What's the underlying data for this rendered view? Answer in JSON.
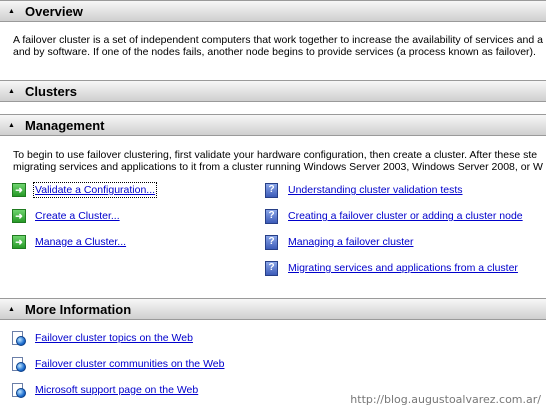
{
  "sections": {
    "overview": {
      "title": "Overview",
      "desc_line1": "A failover cluster is a set of independent computers that work together to increase the availability of services and a",
      "desc_line2": "and by software. If one of the nodes fails, another node begins to provide services (a process known as failover)."
    },
    "clusters": {
      "title": "Clusters"
    },
    "management": {
      "title": "Management",
      "desc_line1": "To begin to use failover clustering, first validate your hardware configuration, then create a cluster.  After these ste",
      "desc_line2": "migrating services and applications to it from a cluster running Windows Server 2003, Windows Server 2008, or W",
      "actions": [
        {
          "label": "Validate a Configuration...",
          "icon": "green-arrow-icon"
        },
        {
          "label": "Create a Cluster...",
          "icon": "green-arrow-icon"
        },
        {
          "label": "Manage a Cluster...",
          "icon": "green-arrow-icon"
        }
      ],
      "help_links": [
        {
          "label": "Understanding cluster validation tests",
          "icon": "help-icon"
        },
        {
          "label": "Creating a failover cluster or adding a cluster node",
          "icon": "help-icon"
        },
        {
          "label": "Managing a failover cluster",
          "icon": "help-icon"
        },
        {
          "label": "Migrating services and applications from a cluster",
          "icon": "help-icon"
        }
      ]
    },
    "more_info": {
      "title": "More Information",
      "links": [
        {
          "label": "Failover cluster topics on the Web",
          "icon": "web-page-icon"
        },
        {
          "label": "Failover cluster communities on the Web",
          "icon": "web-page-icon"
        },
        {
          "label": "Microsoft support page on the Web",
          "icon": "web-page-icon"
        }
      ]
    }
  },
  "watermark": "http://blog.augustoalvarez.com.ar/"
}
